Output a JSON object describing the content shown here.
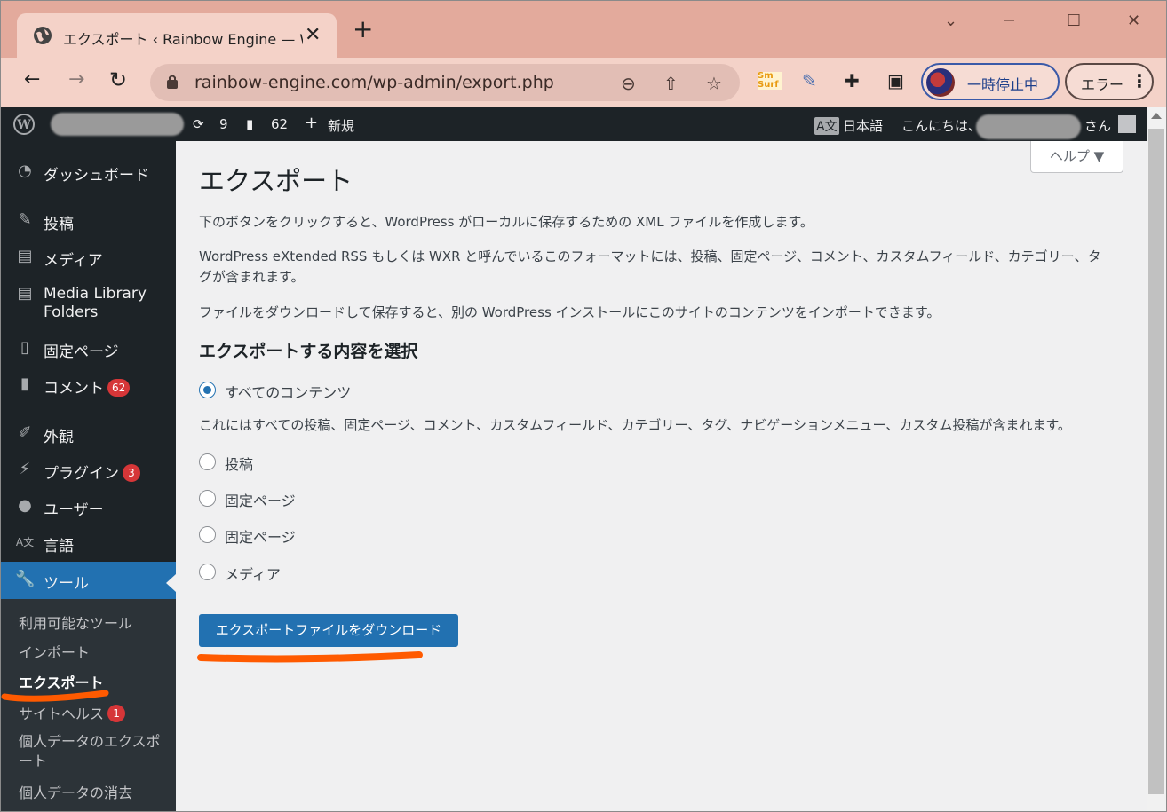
{
  "browser": {
    "tab_title": "エクスポート ‹ Rainbow Engine — W",
    "tab_close": "✕",
    "new_tab": "+",
    "win_min": "─",
    "win_max": "☐",
    "win_close": "✕",
    "back": "←",
    "forward": "→",
    "reload": "↻",
    "url": "rainbow-engine.com/wp-admin/export.php",
    "profile_label": "一時停止中",
    "error_label": "エラー",
    "menu_dots": "⋮",
    "ext_label": "Sm Surf"
  },
  "adminbar": {
    "updates_count": "9",
    "comments_count": "62",
    "new_label": "新規",
    "language": "日本語",
    "greeting": "こんにちは、",
    "greeting_suffix": "さん"
  },
  "sidebar": {
    "items": [
      {
        "label": "ダッシュボード"
      },
      {
        "label": "投稿"
      },
      {
        "label": "メディア"
      },
      {
        "label": "Media Library"
      },
      {
        "label": "Folders"
      },
      {
        "label": "固定ページ"
      },
      {
        "label": "コメント",
        "badge": "62"
      },
      {
        "label": "外観"
      },
      {
        "label": "プラグイン",
        "badge": "3"
      },
      {
        "label": "ユーザー"
      },
      {
        "label": "言語"
      },
      {
        "label": "ツール"
      }
    ],
    "submenu": [
      {
        "label": "利用可能なツール"
      },
      {
        "label": "インポート"
      },
      {
        "label": "エクスポート"
      },
      {
        "label": "サイトヘルス",
        "badge": "1"
      },
      {
        "label": "個人データのエクスポ"
      },
      {
        "label": "ート"
      },
      {
        "label": "個人データの消去"
      }
    ]
  },
  "main": {
    "help_label": "ヘルプ ▼",
    "title": "エクスポート",
    "p1": "下のボタンをクリックすると、WordPress がローカルに保存するための XML ファイルを作成します。",
    "p2a": "WordPress eXtended RSS もしくは WXR と呼んでいるこのフォーマットには、投稿、固定ページ、コメント、カスタムフィールド、カテゴリー、タ",
    "p2b": "グが含まれます。",
    "p3": "ファイルをダウンロードして保存すると、別の WordPress インストールにこのサイトのコンテンツをインポートできます。",
    "section_title": "エクスポートする内容を選択",
    "options": [
      {
        "label": "すべてのコンテンツ",
        "checked": true
      },
      {
        "label": "投稿",
        "checked": false
      },
      {
        "label": "固定ページ",
        "checked": false
      },
      {
        "label": "固定ページ",
        "checked": false
      },
      {
        "label": "メディア",
        "checked": false
      }
    ],
    "all_content_desc": "これにはすべての投稿、固定ページ、コメント、カスタムフィールド、カテゴリー、タグ、ナビゲーションメニュー、カスタム投稿が含まれます。",
    "download_button": "エクスポートファイルをダウンロード"
  },
  "colors": {
    "wp_blue": "#2271b1",
    "adminbar_bg": "#1d2327",
    "annotation_orange": "#ff5a00",
    "tabstrip": "#e3aa9c"
  }
}
